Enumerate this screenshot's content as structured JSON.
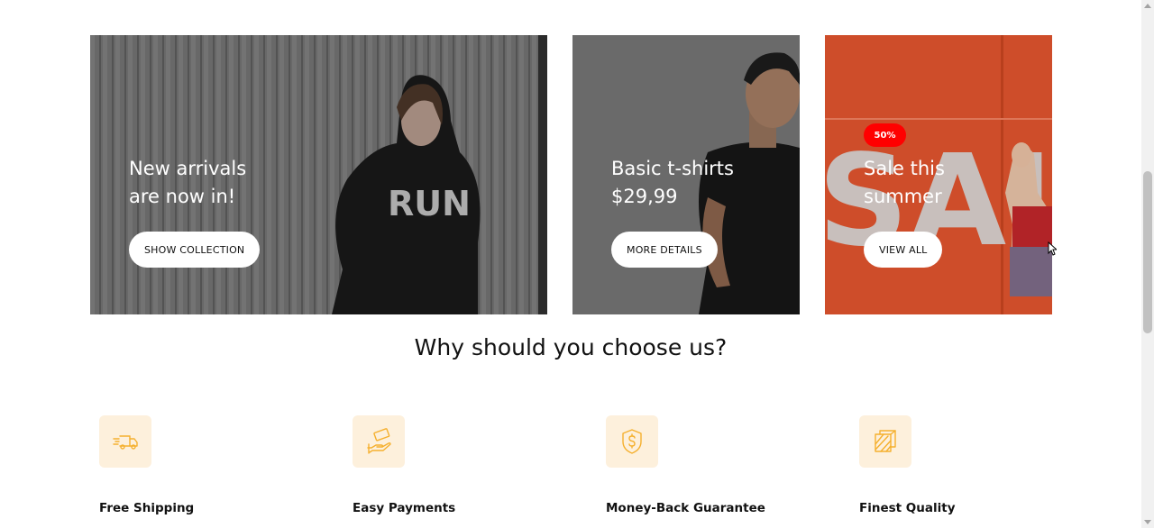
{
  "banners": [
    {
      "title_line1": "New arrivals",
      "title_line2": "are now in!",
      "button": "SHOW COLLECTION",
      "image": "woman-in-run-hoodie-photo"
    },
    {
      "title_line1": "Basic t-shirts",
      "title_line2": "$29,99",
      "button": "MORE DETAILS",
      "image": "man-in-black-tshirt-photo"
    },
    {
      "badge": "50%",
      "title_line1": "Sale this",
      "title_line2": "summer",
      "button": "VIEW ALL",
      "image": "sale-window-woman-photo",
      "wall_text": "SAL"
    }
  ],
  "section": {
    "title": "Why should you choose us?"
  },
  "features": [
    {
      "title": "Free Shipping",
      "icon": "delivery-truck-icon"
    },
    {
      "title": "Easy Payments",
      "icon": "hand-payment-icon"
    },
    {
      "title": "Money-Back Guarantee",
      "icon": "shield-dollar-icon"
    },
    {
      "title": "Finest Quality",
      "icon": "quality-fabric-icon"
    }
  ],
  "colors": {
    "accent": "#f5b02e",
    "icon_bg": "#fdf0dc",
    "badge": "#ff0000"
  }
}
